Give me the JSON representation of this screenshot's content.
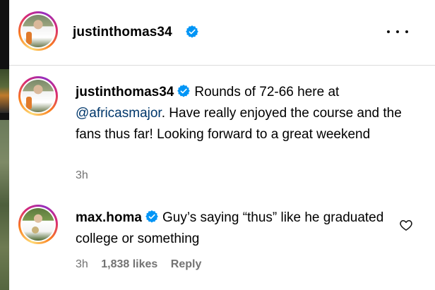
{
  "header": {
    "username": "justinthomas34",
    "avatar_icon": "profile-photo",
    "verified_icon": "verified-badge-icon",
    "more_icon": "more-options-icon"
  },
  "caption": {
    "username": "justinthomas34",
    "text_before_mention": "Rounds of 72-66 here at",
    "mention": "@africasmajor",
    "text_after_mention": ". Have really enjoyed the course and the fans thus far! Looking forward to a great weekend",
    "time": "3h"
  },
  "comments": [
    {
      "username": "max.homa",
      "text": "Guy’s saying “thus” like he graduated college or something",
      "time": "3h",
      "likes": "1,838 likes",
      "reply_label": "Reply"
    }
  ],
  "colors": {
    "verified": "#0095f6",
    "mention": "#00376b",
    "meta": "#737373",
    "divider": "#dbdbdb"
  }
}
